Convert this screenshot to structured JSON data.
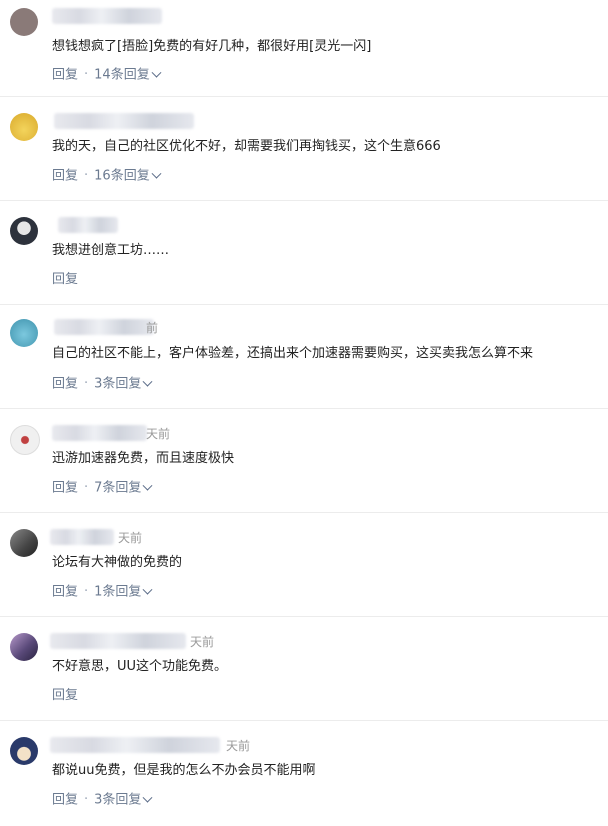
{
  "comments": [
    {
      "text": "想钱想疯了[捂脸]免费的有好几种，都很好用[灵光一闪]",
      "reply": "回复",
      "sep": "·",
      "replies": "14条回复",
      "time": "",
      "avatar_color": "#8a7a78"
    },
    {
      "text": "我的天，自己的社区优化不好，却需要我们再掏钱买，这个生意666",
      "reply": "回复",
      "sep": "·",
      "replies": "16条回复",
      "time": "",
      "avatar_color": "#e8c64a"
    },
    {
      "text": "我想进创意工坊……",
      "reply": "回复",
      "sep": "",
      "replies": "",
      "time": "",
      "avatar_color": "#3a3f4a"
    },
    {
      "text": "自己的社区不能上，客户体验差，还搞出来个加速器需要购买，这买卖我怎么算不来",
      "reply": "回复",
      "sep": "·",
      "replies": "3条回复",
      "time": "前",
      "avatar_color": "#5ab0c8"
    },
    {
      "text": "迅游加速器免费，而且速度极快",
      "reply": "回复",
      "sep": "·",
      "replies": "7条回复",
      "time": "天前",
      "avatar_color": "#d8d8d8"
    },
    {
      "text": "论坛有大神做的免费的",
      "reply": "回复",
      "sep": "·",
      "replies": "1条回复",
      "time": "天前",
      "avatar_color": "#555a60"
    },
    {
      "text": "不好意思，UU这个功能免费。",
      "reply": "回复",
      "sep": "",
      "replies": "",
      "time": "天前",
      "avatar_color": "#6a5a8a"
    },
    {
      "text": "都说uu免费，但是我的怎么不办会员不能用啊",
      "reply": "回复",
      "sep": "·",
      "replies": "3条回复",
      "time": "天前",
      "avatar_color": "#3a4a7a"
    }
  ]
}
